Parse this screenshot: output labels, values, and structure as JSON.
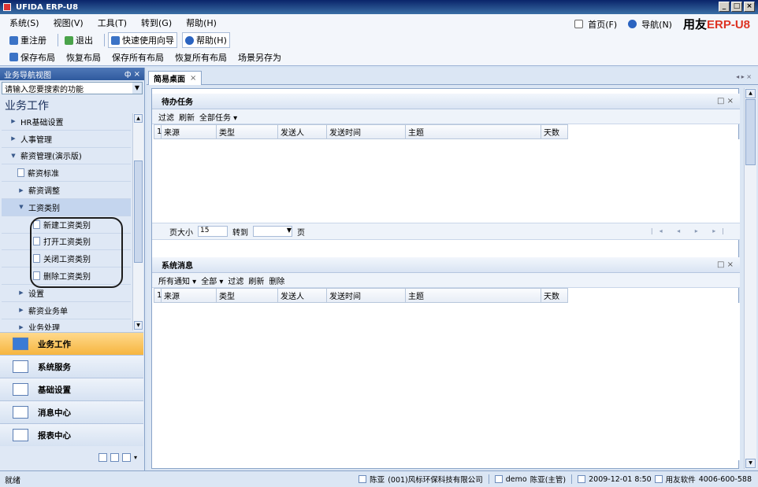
{
  "window": {
    "title": "UFIDA ERP-U8",
    "min": "_",
    "max": "□",
    "close": "×"
  },
  "menu": {
    "items": [
      "系统(S)",
      "视图(V)",
      "工具(T)",
      "转到(G)",
      "帮助(H)"
    ],
    "right": {
      "home": "首页(F)",
      "nav": "导航(N)",
      "logo_text": "用友",
      "logo_erp": "ERP-U8"
    }
  },
  "toolbar1": {
    "items": [
      "重注册",
      "退出",
      "快速使用向导",
      "帮助(H)"
    ]
  },
  "toolbar2": {
    "items": [
      "保存布局",
      "恢复布局",
      "保存所有布局",
      "恢复所有布局",
      "场景另存为"
    ]
  },
  "leftnav": {
    "header": "业务导航视图",
    "pin": "ф ×",
    "search_placeholder": "请输入您要搜索的功能",
    "title": "业务工作",
    "tree": [
      {
        "label": "HR基础设置",
        "type": "collapsed"
      },
      {
        "label": "人事管理",
        "type": "collapsed"
      },
      {
        "label": "薪资管理(演示版)",
        "type": "expanded"
      },
      {
        "label": "薪资标准",
        "type": "doc"
      },
      {
        "label": "薪资调整",
        "type": "collapsed"
      },
      {
        "label": "工资类别",
        "type": "expanded"
      },
      {
        "label": "新建工资类别",
        "type": "doc"
      },
      {
        "label": "打开工资类别",
        "type": "doc"
      },
      {
        "label": "关闭工资类别",
        "type": "doc"
      },
      {
        "label": "删除工资类别",
        "type": "doc"
      },
      {
        "label": "设置",
        "type": "collapsed"
      },
      {
        "label": "薪资业务单",
        "type": "collapsed"
      },
      {
        "label": "业务处理",
        "type": "collapsed"
      }
    ],
    "sections": [
      "业务工作",
      "系统服务",
      "基础设置",
      "消息中心",
      "报表中心"
    ]
  },
  "main": {
    "tab_label": "简易桌面",
    "tab_close": "×",
    "tab_nav": "◂ ▸ ×",
    "todo": {
      "title": "待办任务",
      "controls": "□ ×",
      "tools": [
        "过滤",
        "刷新",
        "全部任务 ▾"
      ],
      "columns": [
        "1",
        "来源",
        "类型",
        "发送人",
        "发送时间",
        "主题",
        "天数"
      ],
      "page_size_label": "页大小",
      "page_size": "15",
      "goto_label": "转到",
      "page_unit": "页",
      "pager_nav": "|◂ ◂ ▸ ▸|"
    },
    "messages": {
      "title": "系统消息",
      "controls": "□ ×",
      "tools": [
        "所有通知 ▾",
        "全部 ▾",
        "过滤",
        "刷新",
        "删除"
      ],
      "columns": [
        "1",
        "来源",
        "类型",
        "发送人",
        "发送时间",
        "主题",
        "天数"
      ]
    }
  },
  "status": {
    "left": "就绪",
    "user": "陈亚",
    "company": "(001)风标环保科技有限公司",
    "account": "demo",
    "role": "陈亚(主管)",
    "datetime": "2009-12-01 8:50",
    "vendor": "用友软件",
    "phone": "4006-600-588"
  }
}
